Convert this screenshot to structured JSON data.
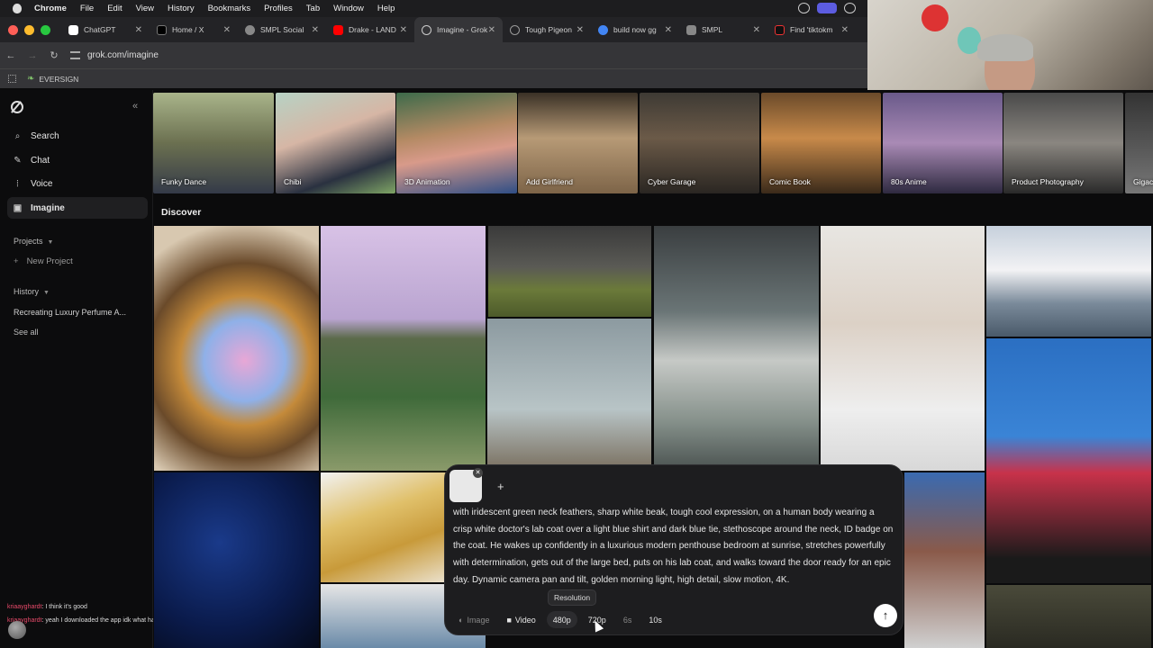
{
  "menubar": {
    "app": "Chrome",
    "items": [
      "File",
      "Edit",
      "View",
      "History",
      "Bookmarks",
      "Profiles",
      "Tab",
      "Window",
      "Help"
    ]
  },
  "tabs": [
    {
      "title": "ChatGPT",
      "color": "#ffffff"
    },
    {
      "title": "Home / X",
      "color": "#000000"
    },
    {
      "title": "SMPL Social",
      "color": "#888888"
    },
    {
      "title": "Drake - LAND",
      "color": "#ff0000"
    },
    {
      "title": "Imagine - Grok",
      "color": "#444444",
      "active": true
    },
    {
      "title": "Tough Pigeon",
      "color": "#666666"
    },
    {
      "title": "build now gg",
      "color": "#4285f4"
    },
    {
      "title": "SMPL",
      "color": "#888888"
    },
    {
      "title": "Find 'tiktokm",
      "color": "#111111"
    }
  ],
  "address": {
    "url": "grok.com/imagine"
  },
  "bookmarks": {
    "items": [
      "EVERSIGN"
    ]
  },
  "sidebar": {
    "nav": [
      {
        "label": "Search",
        "icon": "search-icon"
      },
      {
        "label": "Chat",
        "icon": "chat-icon"
      },
      {
        "label": "Voice",
        "icon": "voice-icon"
      },
      {
        "label": "Imagine",
        "icon": "image-icon",
        "active": true
      }
    ],
    "projects_label": "Projects",
    "new_project": "New Project",
    "history_label": "History",
    "history_items": [
      "Recreating Luxury Perfume A..."
    ],
    "see_all": "See all"
  },
  "stream_chat": [
    {
      "user": "kriaayghardt",
      "message": "I think it's good"
    },
    {
      "user": "kriaayghardt",
      "message": "yeah I downloaded the app idk what happened"
    }
  ],
  "categories": [
    "Funky Dance",
    "Chibi",
    "3D Animation",
    "Add Girlfriend",
    "Cyber Garage",
    "Comic Book",
    "80s Anime",
    "Product Photography",
    "Gigachad"
  ],
  "discover": {
    "title": "Discover"
  },
  "composer": {
    "prompt": "with iridescent green neck feathers, sharp white beak, tough cool expression, on a human body wearing a crisp white doctor's lab coat over a light blue shirt and dark blue tie, stethoscope around the neck, ID badge on the coat. He wakes up confidently in a luxurious modern penthouse bedroom at sunrise, stretches powerfully with determination, gets out of the large bed, puts on his lab coat, and walks toward the door ready for an epic day. Dynamic camera pan and tilt, golden morning light, high detail, slow motion, 4K.",
    "tooltip": "Resolution",
    "modes": [
      "Image",
      "Video"
    ],
    "resolutions": [
      "480p",
      "720p"
    ],
    "durations": [
      "6s",
      "10s"
    ],
    "selected_resolution": "480p"
  }
}
